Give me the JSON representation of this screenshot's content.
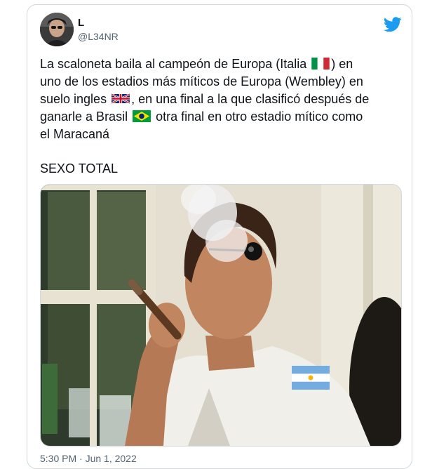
{
  "tweet": {
    "author_name": "L",
    "author_handle": "@L34NR",
    "lines": [
      "La scaloneta baila al campeón de Europa (Italia",
      ") en",
      "uno de los estadios más míticos de Europa (Wembley) en",
      "suelo ingles",
      ", en una final a la que clasificó después de",
      "ganarle a Brasil",
      "otra final en otro estadio mítico como",
      "el Maracaná"
    ],
    "closing": "SEXO TOTAL",
    "timestamp": "5:30 PM · Jun 1, 2022"
  },
  "icons": {
    "brand": "twitter-bird-icon",
    "flags": [
      "italy-flag-icon",
      "uk-flag-icon",
      "brazil-flag-icon",
      "argentina-flag-icon"
    ]
  },
  "colors": {
    "brand": "#1d9bf0",
    "text": "#0f1419",
    "muted": "#536471",
    "border": "#cfd9de"
  }
}
